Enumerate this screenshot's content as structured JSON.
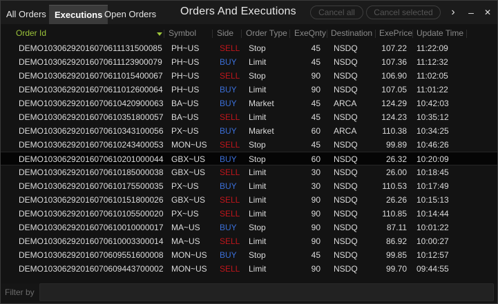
{
  "window": {
    "title": "Orders And Executions",
    "tabs": [
      {
        "label": "All Orders",
        "active": false
      },
      {
        "label": "Executions",
        "active": true
      },
      {
        "label": "Open Orders",
        "active": false
      }
    ],
    "buttons": {
      "cancel_all": "Cancel all",
      "cancel_selected": "Cancel selected"
    },
    "controls": {
      "more": "›",
      "minimize": "–",
      "close": "✕"
    }
  },
  "table": {
    "columns": [
      "Order Id",
      "Symbol",
      "Side",
      "Order Type",
      "ExeQnty",
      "Destination",
      "ExePrice",
      "Update Time"
    ],
    "sorted_column": "Order Id",
    "selected_row": 8,
    "rows": [
      {
        "order_id": "DEMO10306292016070611131500085",
        "symbol": "PH~US",
        "side": "SELL",
        "order_type": "Stop",
        "qty": "45",
        "destination": "NSDQ",
        "price": "107.22",
        "time": "11:22:09"
      },
      {
        "order_id": "DEMO10306292016070611123900079",
        "symbol": "PH~US",
        "side": "BUY",
        "order_type": "Limit",
        "qty": "45",
        "destination": "NSDQ",
        "price": "107.36",
        "time": "11:12:32"
      },
      {
        "order_id": "DEMO10306292016070611015400067",
        "symbol": "PH~US",
        "side": "SELL",
        "order_type": "Stop",
        "qty": "90",
        "destination": "NSDQ",
        "price": "106.90",
        "time": "11:02:05"
      },
      {
        "order_id": "DEMO10306292016070611012600064",
        "symbol": "PH~US",
        "side": "BUY",
        "order_type": "Limit",
        "qty": "90",
        "destination": "NSDQ",
        "price": "107.05",
        "time": "11:01:22"
      },
      {
        "order_id": "DEMO10306292016070610420900063",
        "symbol": "BA~US",
        "side": "BUY",
        "order_type": "Market",
        "qty": "45",
        "destination": "ARCA",
        "price": "124.29",
        "time": "10:42:03"
      },
      {
        "order_id": "DEMO10306292016070610351800057",
        "symbol": "BA~US",
        "side": "SELL",
        "order_type": "Limit",
        "qty": "45",
        "destination": "NSDQ",
        "price": "124.23",
        "time": "10:35:12"
      },
      {
        "order_id": "DEMO10306292016070610343100056",
        "symbol": "PX~US",
        "side": "BUY",
        "order_type": "Market",
        "qty": "60",
        "destination": "ARCA",
        "price": "110.38",
        "time": "10:34:25"
      },
      {
        "order_id": "DEMO10306292016070610243400053",
        "symbol": "MON~US",
        "side": "SELL",
        "order_type": "Stop",
        "qty": "45",
        "destination": "NSDQ",
        "price": "99.89",
        "time": "10:46:26"
      },
      {
        "order_id": "DEMO10306292016070610201000044",
        "symbol": "GBX~US",
        "side": "BUY",
        "order_type": "Stop",
        "qty": "60",
        "destination": "NSDQ",
        "price": "26.32",
        "time": "10:20:09"
      },
      {
        "order_id": "DEMO10306292016070610185000038",
        "symbol": "GBX~US",
        "side": "SELL",
        "order_type": "Limit",
        "qty": "30",
        "destination": "NSDQ",
        "price": "26.00",
        "time": "10:18:45"
      },
      {
        "order_id": "DEMO10306292016070610175500035",
        "symbol": "PX~US",
        "side": "BUY",
        "order_type": "Limit",
        "qty": "30",
        "destination": "NSDQ",
        "price": "110.53",
        "time": "10:17:49"
      },
      {
        "order_id": "DEMO10306292016070610151800026",
        "symbol": "GBX~US",
        "side": "SELL",
        "order_type": "Limit",
        "qty": "90",
        "destination": "NSDQ",
        "price": "26.26",
        "time": "10:15:13"
      },
      {
        "order_id": "DEMO10306292016070610105500020",
        "symbol": "PX~US",
        "side": "SELL",
        "order_type": "Limit",
        "qty": "90",
        "destination": "NSDQ",
        "price": "110.85",
        "time": "10:14:44"
      },
      {
        "order_id": "DEMO10306292016070610010000017",
        "symbol": "MA~US",
        "side": "BUY",
        "order_type": "Stop",
        "qty": "90",
        "destination": "NSDQ",
        "price": "87.11",
        "time": "10:01:22"
      },
      {
        "order_id": "DEMO10306292016070610003300014",
        "symbol": "MA~US",
        "side": "SELL",
        "order_type": "Limit",
        "qty": "90",
        "destination": "NSDQ",
        "price": "86.92",
        "time": "10:00:27"
      },
      {
        "order_id": "DEMO10306292016070609551600008",
        "symbol": "MON~US",
        "side": "BUY",
        "order_type": "Stop",
        "qty": "45",
        "destination": "NSDQ",
        "price": "99.85",
        "time": "10:12:57"
      },
      {
        "order_id": "DEMO10306292016070609443700002",
        "symbol": "MON~US",
        "side": "SELL",
        "order_type": "Limit",
        "qty": "90",
        "destination": "NSDQ",
        "price": "99.70",
        "time": "09:44:55"
      }
    ]
  },
  "filter": {
    "label": "Filter by",
    "value": ""
  },
  "colors": {
    "sell": "#c0151b",
    "buy": "#3b6fd8",
    "sorted_header": "#9cc43a"
  }
}
